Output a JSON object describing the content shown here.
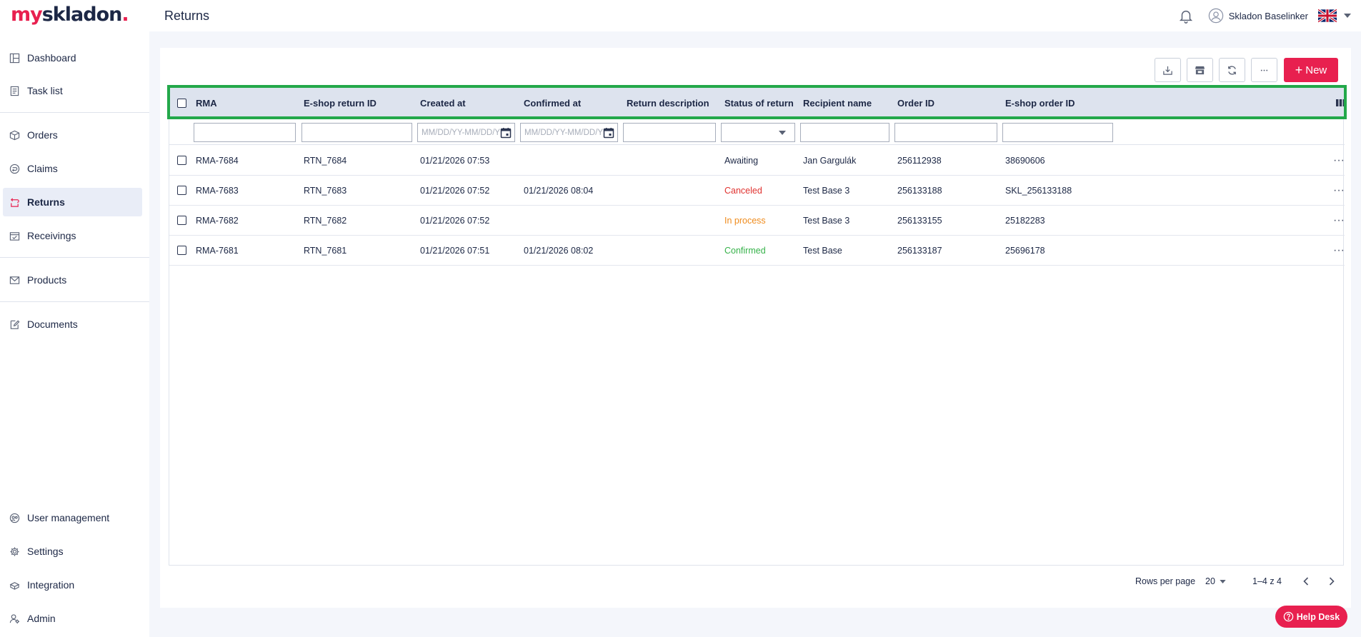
{
  "app": {
    "logo_my": "my",
    "logo_rest": "skladon",
    "logo_dot": ".",
    "page_title": "Returns",
    "user_name": "Skladon Baselinker"
  },
  "sidebar": {
    "items": [
      {
        "label": "Dashboard",
        "icon": "dashboard-icon"
      },
      {
        "label": "Task list",
        "icon": "task-list-icon"
      },
      {
        "label": "Orders",
        "icon": "orders-box-icon"
      },
      {
        "label": "Claims",
        "icon": "claims-icon"
      },
      {
        "label": "Returns",
        "icon": "returns-icon",
        "active": true
      },
      {
        "label": "Receivings",
        "icon": "receivings-icon"
      },
      {
        "label": "Products",
        "icon": "products-icon"
      },
      {
        "label": "Documents",
        "icon": "documents-icon"
      },
      {
        "label": "User management",
        "icon": "user-management-icon"
      },
      {
        "label": "Settings",
        "icon": "gear-icon"
      },
      {
        "label": "Integration",
        "icon": "integration-icon"
      },
      {
        "label": "Admin",
        "icon": "admin-icon"
      }
    ]
  },
  "toolbar": {
    "new_label": "New"
  },
  "table": {
    "columns": [
      "RMA",
      "E-shop return ID",
      "Created at",
      "Confirmed at",
      "Return description",
      "Status of return",
      "Recipient name",
      "Order ID",
      "E-shop order ID"
    ],
    "date_placeholder": "MM/DD/YY-MM/DD/YY",
    "rows": [
      {
        "rma": "RMA-7684",
        "eshop_return_id": "RTN_7684",
        "created_at": "01/21/2026 07:53",
        "confirmed_at": "",
        "description": "",
        "status": "Awaiting",
        "recipient": "Jan Gargulák",
        "order_id": "256112938",
        "eshop_order_id": "38690606"
      },
      {
        "rma": "RMA-7683",
        "eshop_return_id": "RTN_7683",
        "created_at": "01/21/2026 07:52",
        "confirmed_at": "01/21/2026 08:04",
        "description": "",
        "status": "Canceled",
        "recipient": "Test Base 3",
        "order_id": "256133188",
        "eshop_order_id": "SKL_256133188"
      },
      {
        "rma": "RMA-7682",
        "eshop_return_id": "RTN_7682",
        "created_at": "01/21/2026 07:52",
        "confirmed_at": "",
        "description": "",
        "status": "In process",
        "recipient": "Test Base 3",
        "order_id": "256133155",
        "eshop_order_id": "25182283"
      },
      {
        "rma": "RMA-7681",
        "eshop_return_id": "RTN_7681",
        "created_at": "01/21/2026 07:51",
        "confirmed_at": "01/21/2026 08:02",
        "description": "",
        "status": "Confirmed",
        "recipient": "Test Base",
        "order_id": "256133187",
        "eshop_order_id": "25696178"
      }
    ],
    "row_actions": "···"
  },
  "pagination": {
    "rows_per_page_label": "Rows per page",
    "rows_per_page": "20",
    "range": "1–4 z 4"
  },
  "help_desk": {
    "label": "Help Desk"
  },
  "colors": {
    "brand": "#e8204f",
    "header_highlight": "#23a84a",
    "status_canceled": "#e0322f",
    "status_inprocess": "#ef8b1c",
    "status_confirmed": "#36b24a"
  }
}
